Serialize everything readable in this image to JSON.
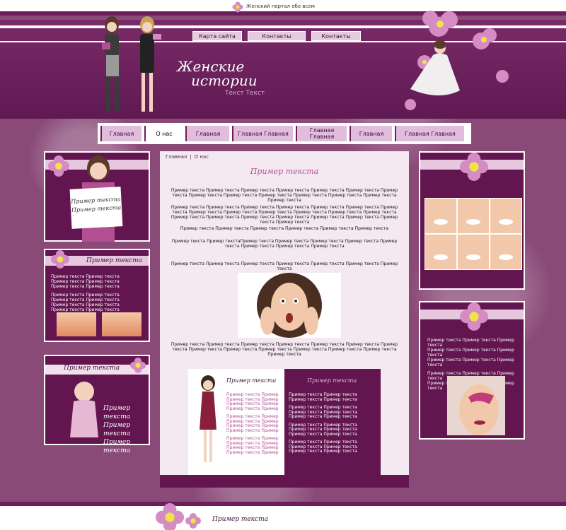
{
  "top": {
    "tagline": "Женский портал обо всем"
  },
  "header": {
    "title_line1": "Женские",
    "title_line2": "истории",
    "subtitle": "Текст Текст",
    "top_links": [
      "Карта сайта",
      "Контакты",
      "Контакты"
    ]
  },
  "mainnav": {
    "items": [
      {
        "label": "Главная",
        "active": false
      },
      {
        "label": "О нас",
        "active": true
      },
      {
        "label": "Главная",
        "active": false
      },
      {
        "label": "Главная Главная",
        "active": false
      },
      {
        "label": "Главная Главная",
        "active": false
      },
      {
        "label": "Главная",
        "active": false
      },
      {
        "label": "Главная Главная",
        "active": false
      }
    ]
  },
  "left": {
    "card_sign": "Пример текста Пример текста",
    "box2_title": "Пример текста",
    "box2_lines": [
      "Пример текста Пример текста",
      "Пример текста Пример текста",
      "Пример текста Пример текста",
      "Пример текста Пример текста",
      "Пример текста Пример текста",
      "Пример текста Пример текста",
      "Пример текста Пример текста"
    ],
    "box3_title": "Пример текста",
    "box3_lines": [
      "Пример текста",
      "Пример текста",
      "Пример текста"
    ]
  },
  "center": {
    "breadcrumb_home": "Главная",
    "breadcrumb_current": "О нас",
    "title": "Пример текста",
    "para1": "Пример текста Пример текста Пример текста Пример текста Пример текста Пример текста Пример текста Пример текста Пример текста Пример текста Пример текста Пример текста Пример текста Пример текста",
    "para2": "Пример текста Пример текста Пример текста Пример текста Пример текста Пример текста Пример текста Пример текста Пример текста Пример текста Пример текста Пример текста Пример текста Пример текста Пример текста Пример текста Пример текста Пример текста Пример текста Пример текста Пример текста",
    "para3": "Пример текста Пример текста Пример текста Пример текста Пример текста Пример текста",
    "para4": "Пример текста Пример текстаПример текста Пример текста Пример текста Пример текста Пример текста Пример текста Пример текста Пример текста",
    "para5": "Пример текста Пример текста Пример текста Пример текста Пример текста Пример текста Пример текста",
    "para6": "Пример текста Пример текста Пример текста Пример текста Пример текста Пример текста Пример текста Пример текста Пример текста Пример текста Пример текста Пример текста Пример текста Пример текста",
    "sub_left_title": "Пример текста",
    "sub_left_lines": [
      "Пример текста Пример",
      "Пример текста Пример",
      "Пример текста Пример",
      "Пример текста Пример",
      "Пример текста Пример",
      "Пример текста Пример",
      "Пример текста Пример",
      "Пример текста Пример",
      "Пример текста Пример",
      "Пример текста Пример",
      "Пример текста Пример",
      "Пример текста Пример"
    ],
    "sub_right_title": "Пример текста",
    "sub_right_lines": [
      "Пример текста Пример текста",
      "Пример текста Пример текста",
      "Пример текста Пример текста",
      "Пример текста Пример текста",
      "Пример текста Пример текста",
      "Пример текста Пример текста",
      "Пример текста Пример текста",
      "Пример текста Пример текста",
      "Пример текста Пример текста",
      "Пример текста Пример текста",
      "Пример текста Пример текста"
    ]
  },
  "right": {
    "box2_lines": [
      "Пример текста Пример текста Пример текста",
      "Пример текста Пример текста Пример текста",
      "Пример текста Пример текста Пример текста",
      "Пример текста Пример текста Пример текста",
      "Пример текста Пример текста Пример текста"
    ]
  },
  "footer": {
    "text": "Пример текста"
  },
  "colors": {
    "primary": "#62154f",
    "light": "#e6c7de",
    "accent": "#b24f93",
    "bg": "#8a4a78"
  }
}
